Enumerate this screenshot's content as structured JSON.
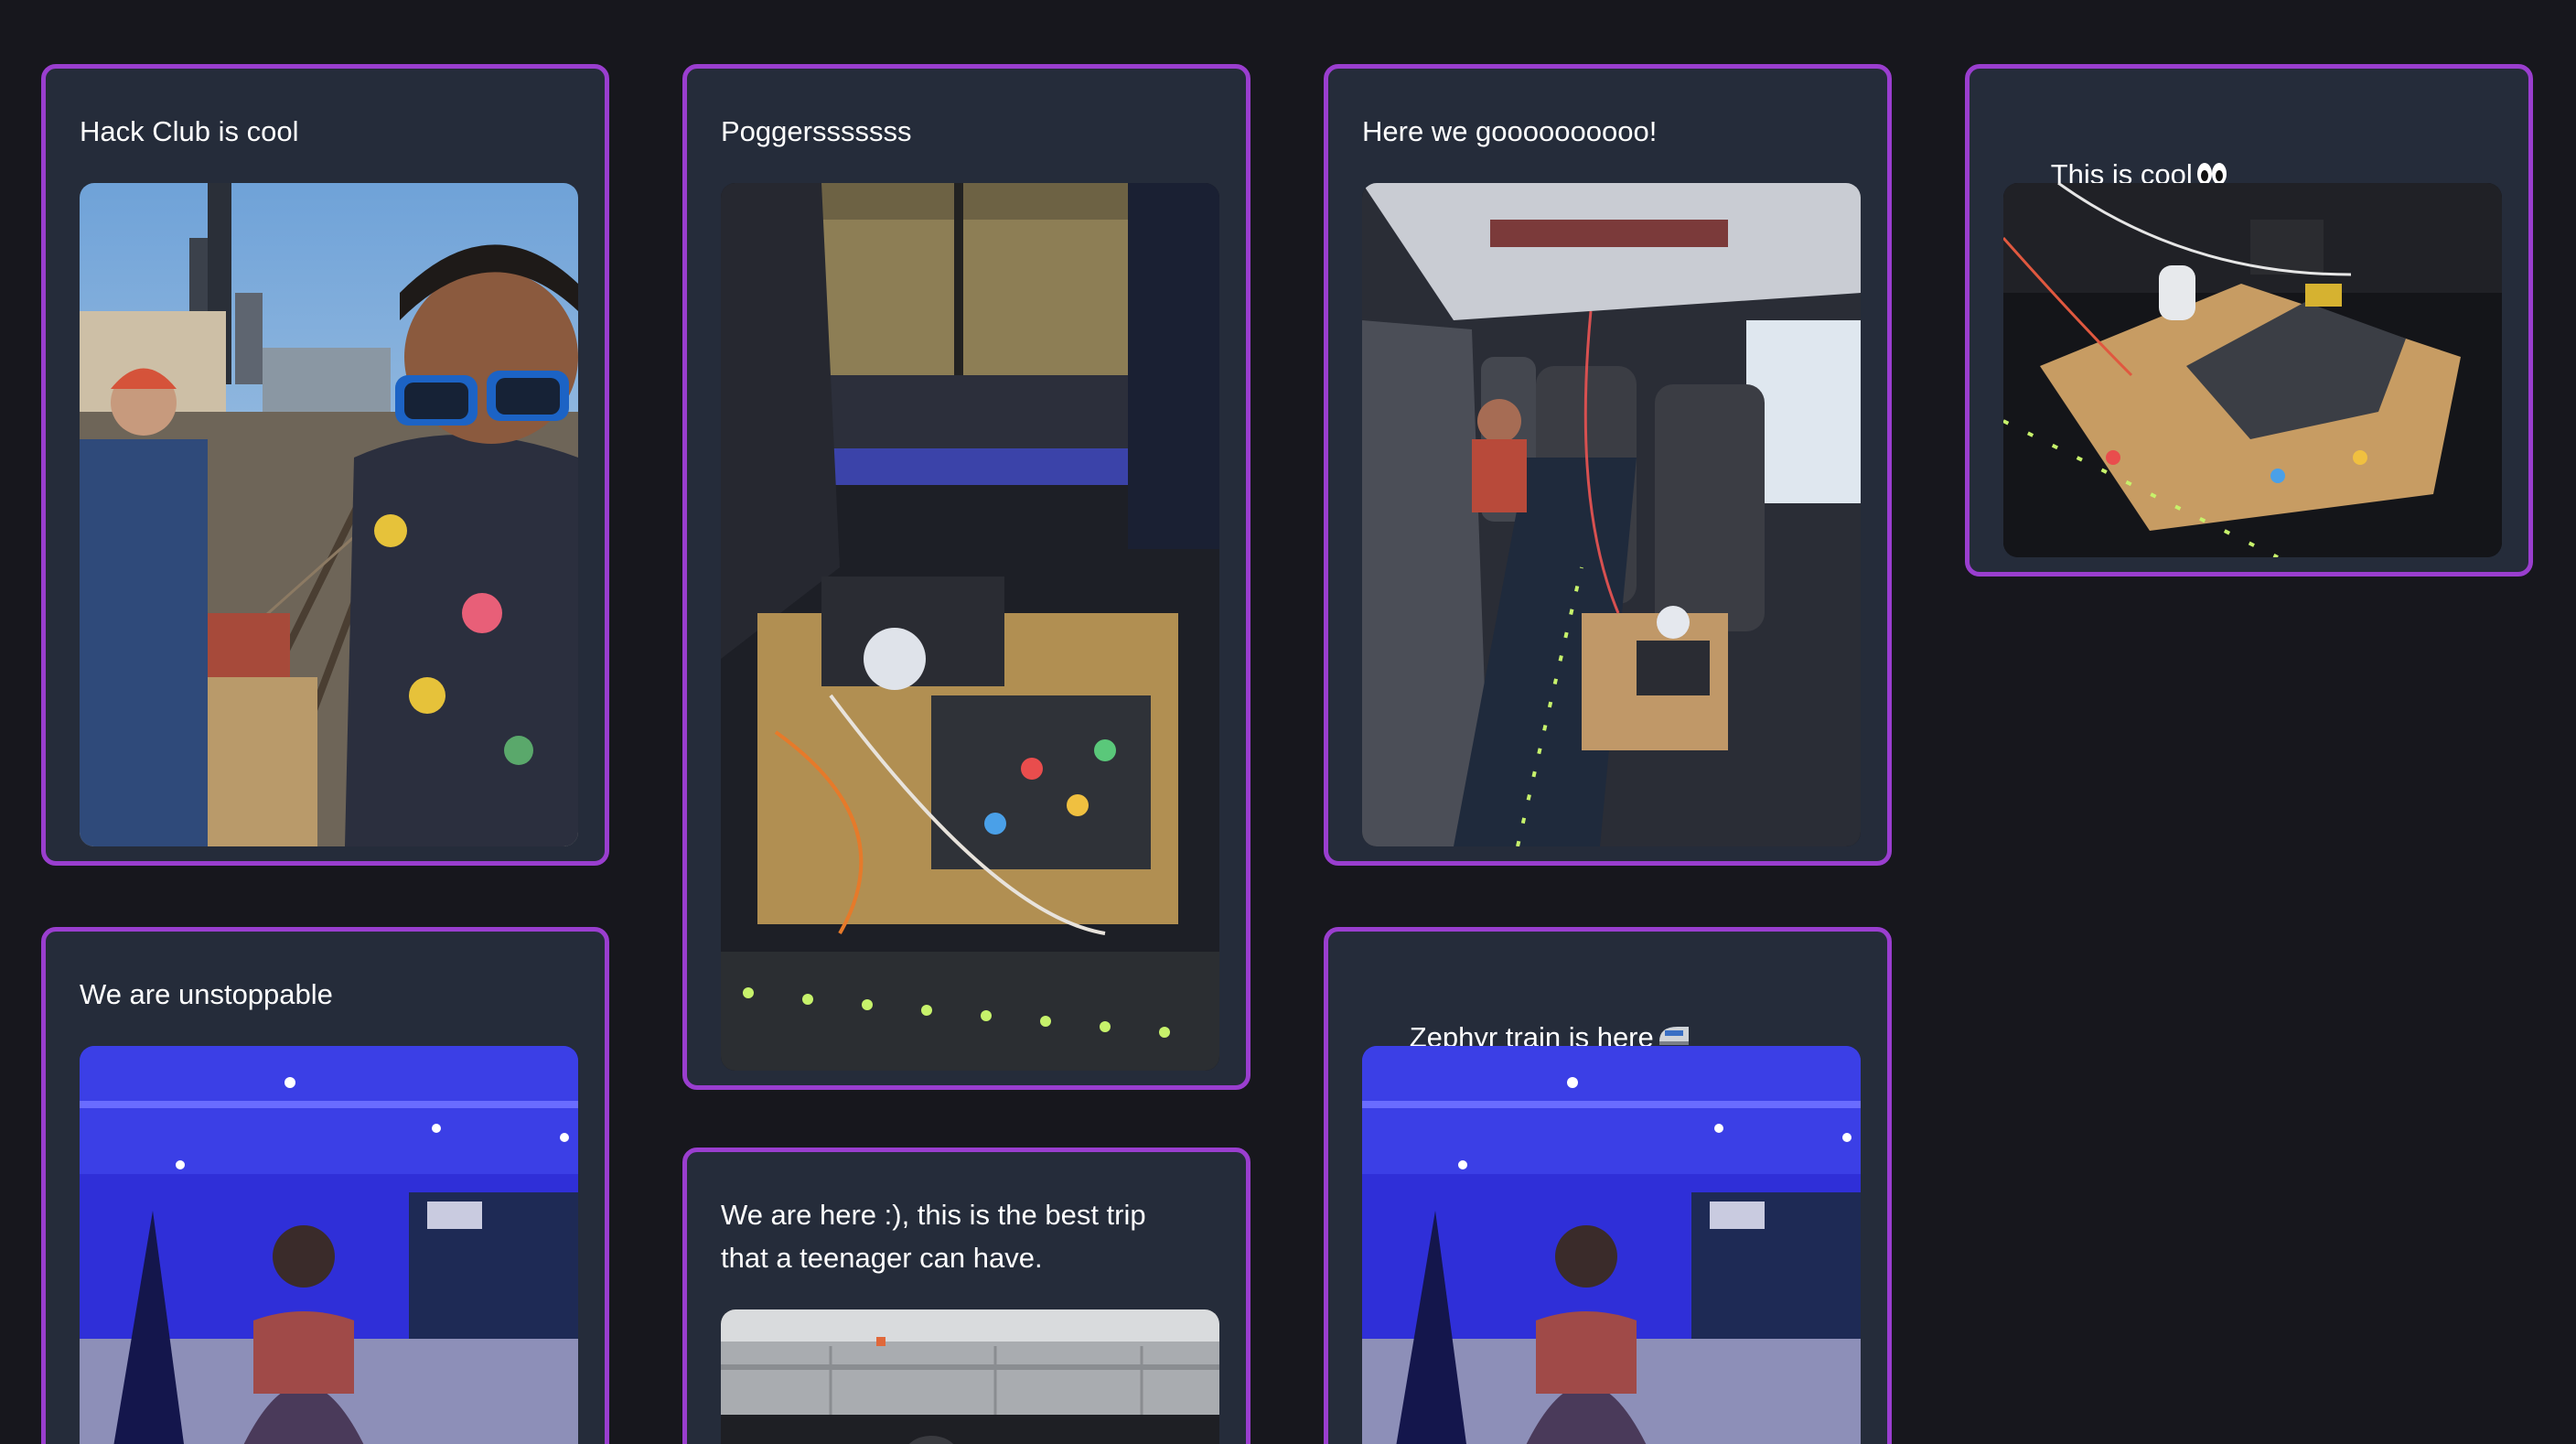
{
  "page": {
    "background": "#17171d",
    "card_background": "#252c3a",
    "card_border": "#9a3ecf"
  },
  "cards": [
    {
      "caption": "Hack Club is cool",
      "photo": "selfie-by-train-tracks",
      "photo_alt": "Two people smiling beside train tracks with city skyline"
    },
    {
      "caption": "Poggersssssss",
      "photo": "train-seat-electronics-setup",
      "photo_alt": "Electronics on a wooden box under a train window"
    },
    {
      "caption": "Here we goooooooooo!",
      "photo": "train-aisle-with-setup",
      "photo_alt": "Train coach aisle with seats and an electronics box"
    },
    {
      "caption": "This is cool",
      "caption_emoji": "eyes-emoji",
      "photo": "laptop-on-wooden-box",
      "photo_alt": "Laptop and cables on a wooden box on the train floor"
    },
    {
      "caption": "We are unstoppable",
      "photo": "blue-lit-room-person",
      "photo_alt": "Person in a room lit with blue light"
    },
    {
      "caption": "We are here :), this is the best trip\nthat a teenager can have.",
      "photo": "train-exterior",
      "photo_alt": "Side of a silver train"
    },
    {
      "caption": "Zephyr train is here",
      "caption_emoji": "train-emoji",
      "photo": "blue-lit-room-person",
      "photo_alt": "Person in a room lit with blue light"
    }
  ]
}
